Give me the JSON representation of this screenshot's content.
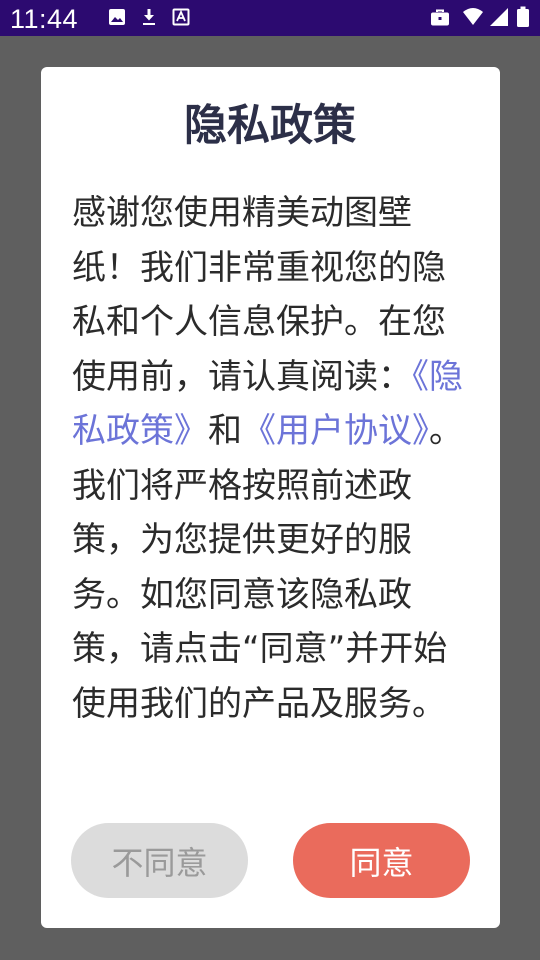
{
  "status_bar": {
    "time": "11:44",
    "left_icons": [
      "image-icon",
      "download-icon",
      "text-recognition-icon"
    ],
    "right_icons": [
      "briefcase-icon",
      "wifi-icon",
      "signal-icon",
      "battery-icon"
    ],
    "background_color": "#2c0a70"
  },
  "dialog": {
    "title": "隐私政策",
    "body": {
      "text_1": "感谢您使用精美动图壁纸！我们非常重视您的隐私和个人信息保护。在您使用前，请认真阅读：",
      "privacy_link": "《隐私政策》",
      "text_2": "和",
      "user_agreement_link": "《用户协议》",
      "text_3": "。我们将严格按照前述政策，为您提供更好的服务。如您同意该隐私政策，请点击“同意”并开始使用我们的产品及服务。"
    },
    "buttons": {
      "decline_label": "不同意",
      "agree_label": "同意"
    },
    "colors": {
      "link": "#6c74d8",
      "agree_button": "#ea6b5c",
      "decline_button": "#dcdcdc",
      "title": "#2c2f48"
    }
  }
}
